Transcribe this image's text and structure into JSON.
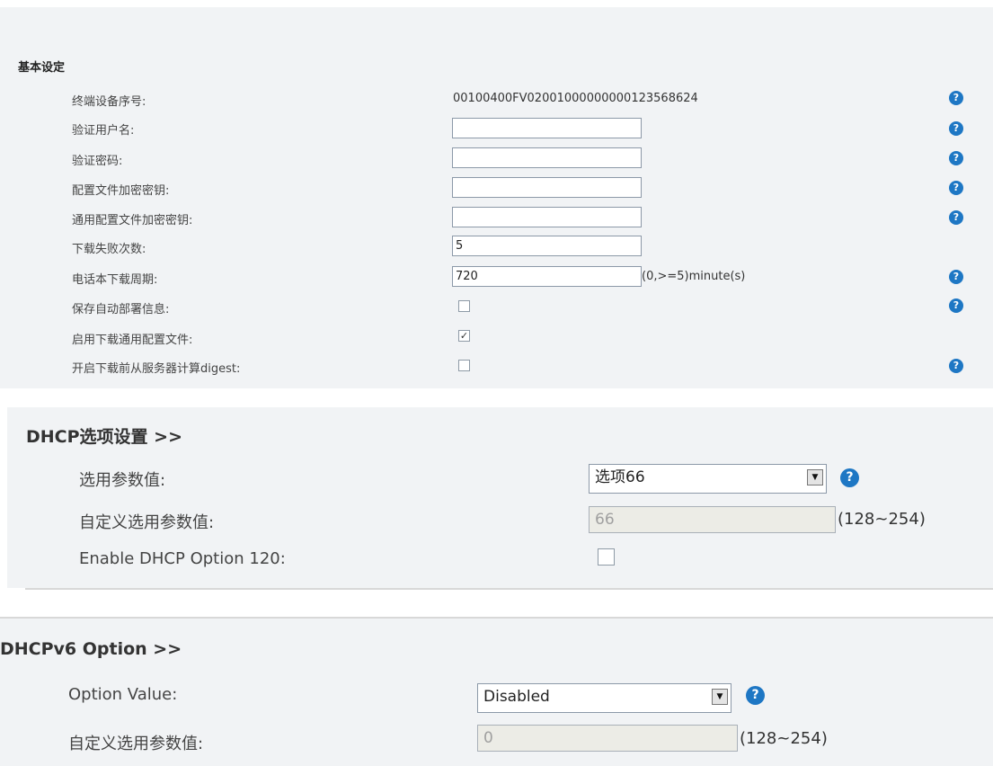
{
  "basic": {
    "title": "基本设定",
    "rows": [
      {
        "label": "终端设备序号:",
        "value": "00100400FV02001000000000123568624"
      },
      {
        "label": "验证用户名:",
        "value": ""
      },
      {
        "label": "验证密码:",
        "value": ""
      },
      {
        "label": "配置文件加密密钥:",
        "value": ""
      },
      {
        "label": "通用配置文件加密密钥:",
        "value": ""
      },
      {
        "label": "下载失败次数:",
        "value": "5"
      },
      {
        "label": "电话本下载周期:",
        "value": "720",
        "suffix": "(0,>=5)minute(s)"
      },
      {
        "label": "保存自动部署信息:",
        "checked": false
      },
      {
        "label": "启用下载通用配置文件:",
        "checked": true
      },
      {
        "label": "开启下载前从服务器计算digest:",
        "checked": false
      }
    ]
  },
  "dhcp": {
    "title": "DHCP选项设置 >>",
    "option_label": "选用参数值:",
    "option_selected": "选项66",
    "custom_label": "自定义选用参数值:",
    "custom_value": "66",
    "custom_range": "(128~254)",
    "enable120_label": "Enable DHCP Option 120:",
    "enable120_checked": false
  },
  "dhcpv6": {
    "title": "DHCPv6 Option >>",
    "option_label": "Option Value:",
    "option_selected": "Disabled",
    "custom_label": "自定义选用参数值:",
    "custom_value": "0",
    "custom_range": "(128~254)"
  },
  "icons": {
    "help": "question-circle-icon",
    "help_glyph": "?",
    "dropdown": "dropdown-arrow-icon",
    "dropdown_glyph": "▼",
    "checkmark_glyph": "✓"
  },
  "colors": {
    "panel_bg": "#f1f3f5",
    "help_icon": "#1e77c4",
    "disabled_input_bg": "#ecece6"
  }
}
